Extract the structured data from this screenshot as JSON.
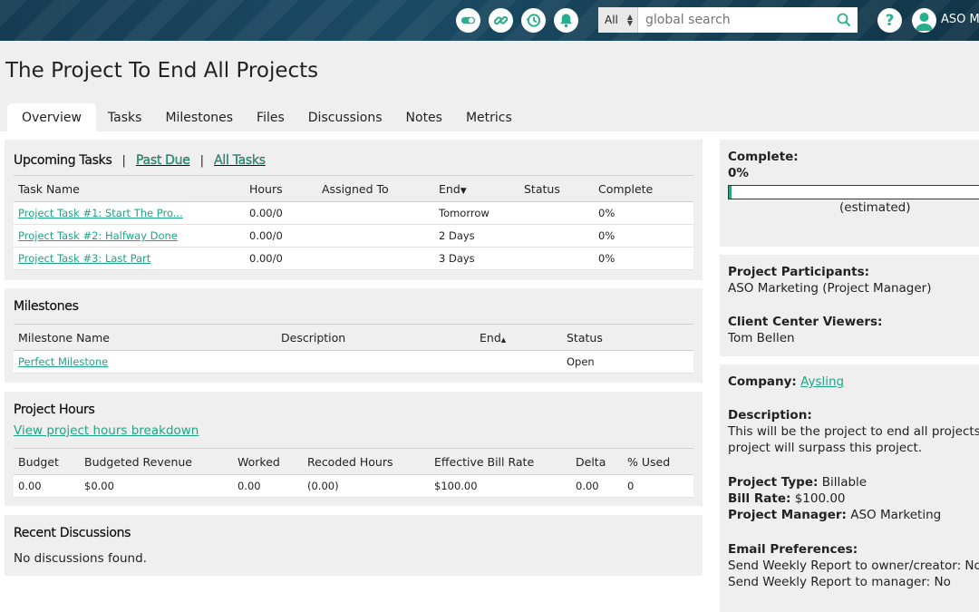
{
  "topbar": {
    "icons": [
      "toggle-icon",
      "link-icon",
      "history-icon",
      "bell-icon"
    ],
    "search_scope": "All",
    "search_placeholder": "global search",
    "help_label": "?",
    "user_name": "ASO Marketing"
  },
  "header": {
    "title": "The Project To End All Projects",
    "tabs": [
      {
        "label": "Overview",
        "active": true
      },
      {
        "label": "Tasks"
      },
      {
        "label": "Milestones"
      },
      {
        "label": "Files"
      },
      {
        "label": "Discussions"
      },
      {
        "label": "Notes"
      },
      {
        "label": "Metrics"
      }
    ]
  },
  "tasks": {
    "title": "Upcoming Tasks",
    "sep": "|",
    "past_due": "Past Due",
    "all_tasks": "All Tasks",
    "columns": [
      "Task Name",
      "Hours",
      "Assigned To",
      "End",
      "Status",
      "Complete"
    ],
    "rows": [
      {
        "name": "Project Task #1: Start The Pro...",
        "hours": "0.00/0",
        "assigned": "",
        "end": "Tomorrow",
        "status": "",
        "complete": "0%"
      },
      {
        "name": "Project Task #2: Halfway Done",
        "hours": "0.00/0",
        "assigned": "",
        "end": "2 Days",
        "status": "",
        "complete": "0%"
      },
      {
        "name": "Project Task #3: Last Part",
        "hours": "0.00/0",
        "assigned": "",
        "end": "3 Days",
        "status": "",
        "complete": "0%"
      }
    ]
  },
  "milestones": {
    "title": "Milestones",
    "columns": [
      "Milestone Name",
      "Description",
      "End",
      "Status"
    ],
    "rows": [
      {
        "name": "Perfect Milestone",
        "description": "",
        "end": "",
        "status": "Open"
      }
    ]
  },
  "hours": {
    "title": "Project Hours",
    "breakdown_link": "View project hours breakdown",
    "columns": [
      "Budget",
      "Budgeted Revenue",
      "Worked",
      "Recoded Hours",
      "Effective Bill Rate",
      "Delta",
      "% Used"
    ],
    "rows": [
      [
        "0.00",
        "$0.00",
        "0.00",
        "(0.00)",
        "$100.00",
        "0.00",
        "0"
      ]
    ]
  },
  "discussions": {
    "title": "Recent Discussions",
    "empty": "No discussions found."
  },
  "sidebar": {
    "complete_label": "Complete:",
    "complete_value": "0%",
    "complete_fraction": 0.01,
    "estimated": "(estimated)",
    "participants_label": "Project Participants:",
    "participants_value": "ASO Marketing (Project Manager)",
    "viewers_label": "Client Center Viewers:",
    "viewers_value": "Tom Bellen",
    "company_label": "Company:",
    "company_value": "Aysling",
    "description_label": "Description:",
    "description_line1": "This will be the project to end all projects. No",
    "description_line2": "project will surpass this project.",
    "type_label": "Project Type:",
    "type_value": "Billable",
    "rate_label": "Bill Rate:",
    "rate_value": "$100.00",
    "manager_label": "Project Manager:",
    "manager_value": "ASO Marketing",
    "email_label": "Email Preferences:",
    "email_owner": "Send Weekly Report to owner/creator: No",
    "email_manager": "Send Weekly Report to manager: No"
  },
  "colors": {
    "accent": "#1fa585",
    "topbar": "#173f56",
    "panel": "#efefef"
  }
}
